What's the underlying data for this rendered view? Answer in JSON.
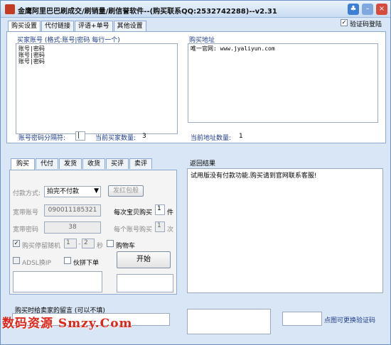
{
  "window": {
    "title": "金鹰阿里巴巴刷成交/刷销量/刷信誉软件--(购买联系QQ:2532742288)--v2.31"
  },
  "top_tabs": [
    "购买设置",
    "代付链接",
    "评语+单号",
    "其他设置"
  ],
  "verify_login_label": "验证码登陆",
  "buyers": {
    "label": "买家账号 (格式:账号|密码 每行一个)",
    "content": "账号|密码\n账号|密码\n账号|密码",
    "separator_label": "账号密码分隔符:",
    "separator_value": "|",
    "count_label": "当前买家数量:",
    "count_value": "3"
  },
  "address": {
    "label": "购买地址",
    "content": "唯一官网: www.jyaliyun.com",
    "count_label": "当前地址数量:",
    "count_value": "1"
  },
  "sub_tabs": [
    "购买",
    "代付",
    "发货",
    "收货",
    "买评",
    "卖评"
  ],
  "buy": {
    "payment_label": "付款方式:",
    "payment_value": "拍完不付款",
    "red_packet_button": "发红包般",
    "broadband_account_label": "宽带账号",
    "broadband_account_value": "090011185321",
    "per_item_label": "每次宝贝购买",
    "per_item_value": "1",
    "per_item_unit": "件",
    "broadband_password_label": "宽带密码",
    "broadband_password_value": "38",
    "per_account_label": "每个账号购买",
    "per_account_value": "1",
    "per_account_unit": "次",
    "random_stop_label": "购买停留随机",
    "random_min": "1",
    "random_max": "2",
    "random_unit": "秒",
    "cart_label": "购物车",
    "adsl_label": "ADSL换IP",
    "combine_label": "伙拼下单",
    "start_button": "开始"
  },
  "result": {
    "label": "返回结果",
    "content": "试用版没有付款功能.购买请到官网联系客服!"
  },
  "message": {
    "label": "购买时给卖家的留言 (可以不填)"
  },
  "captcha_hint": "点图可更换验证码",
  "watermark": "数码资源 Smzy.Com"
}
